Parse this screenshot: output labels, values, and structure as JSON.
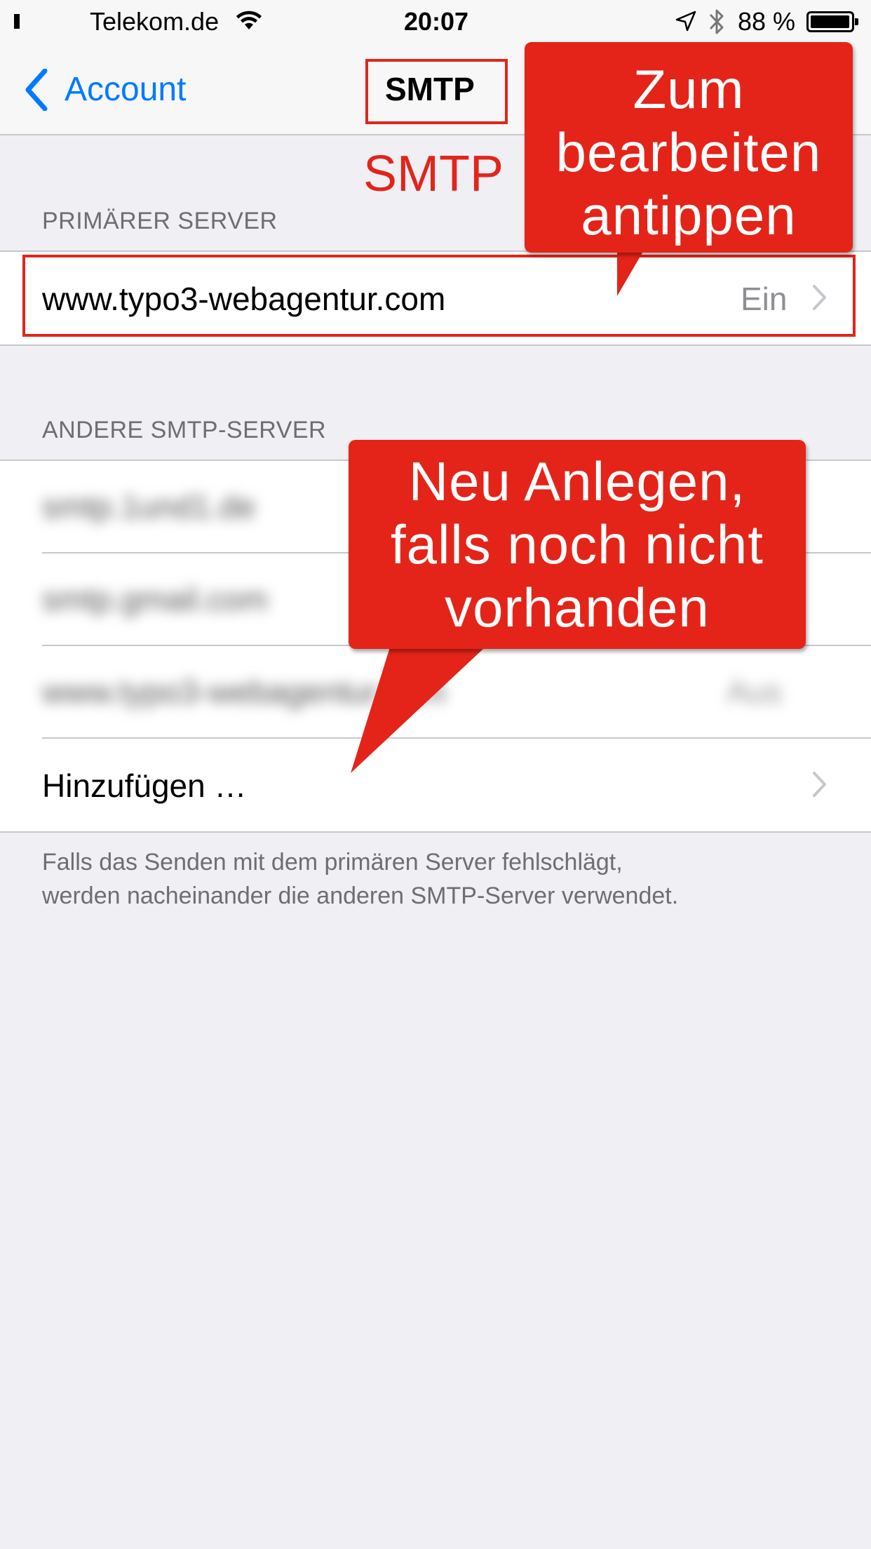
{
  "status_bar": {
    "carrier": "Telekom.de",
    "time": "20:07",
    "battery_percent": "88 %",
    "signal_bars_filled": 3,
    "signal_bars_total": 5
  },
  "nav": {
    "back_label": "Account",
    "title": "SMTP"
  },
  "primary": {
    "header": "PRIMÄRER SERVER",
    "server": "www.typo3-webagentur.com",
    "state": "Ein"
  },
  "others": {
    "header": "ANDERE SMTP-SERVER",
    "servers": [
      {
        "name": "smtp.1und1.de"
      },
      {
        "name": "smtp.gmail.com"
      },
      {
        "name": "www.typo3-webagentur.com",
        "state": "Aus"
      }
    ],
    "add_label": "Hinzufügen …"
  },
  "footer": {
    "line1": "Falls das Senden mit dem primären Server fehlschlägt,",
    "line2": "werden nacheinander die anderen SMTP-Server verwendet."
  },
  "annotations": {
    "title_label": "SMTP",
    "callout_edit": [
      "Zum",
      "bearbeiten",
      "antippen"
    ],
    "callout_new": [
      "Neu Anlegen,",
      "falls noch nicht",
      "vorhanden"
    ]
  },
  "colors": {
    "ios_blue": "#007aff",
    "annotation_red": "#e1251b"
  }
}
